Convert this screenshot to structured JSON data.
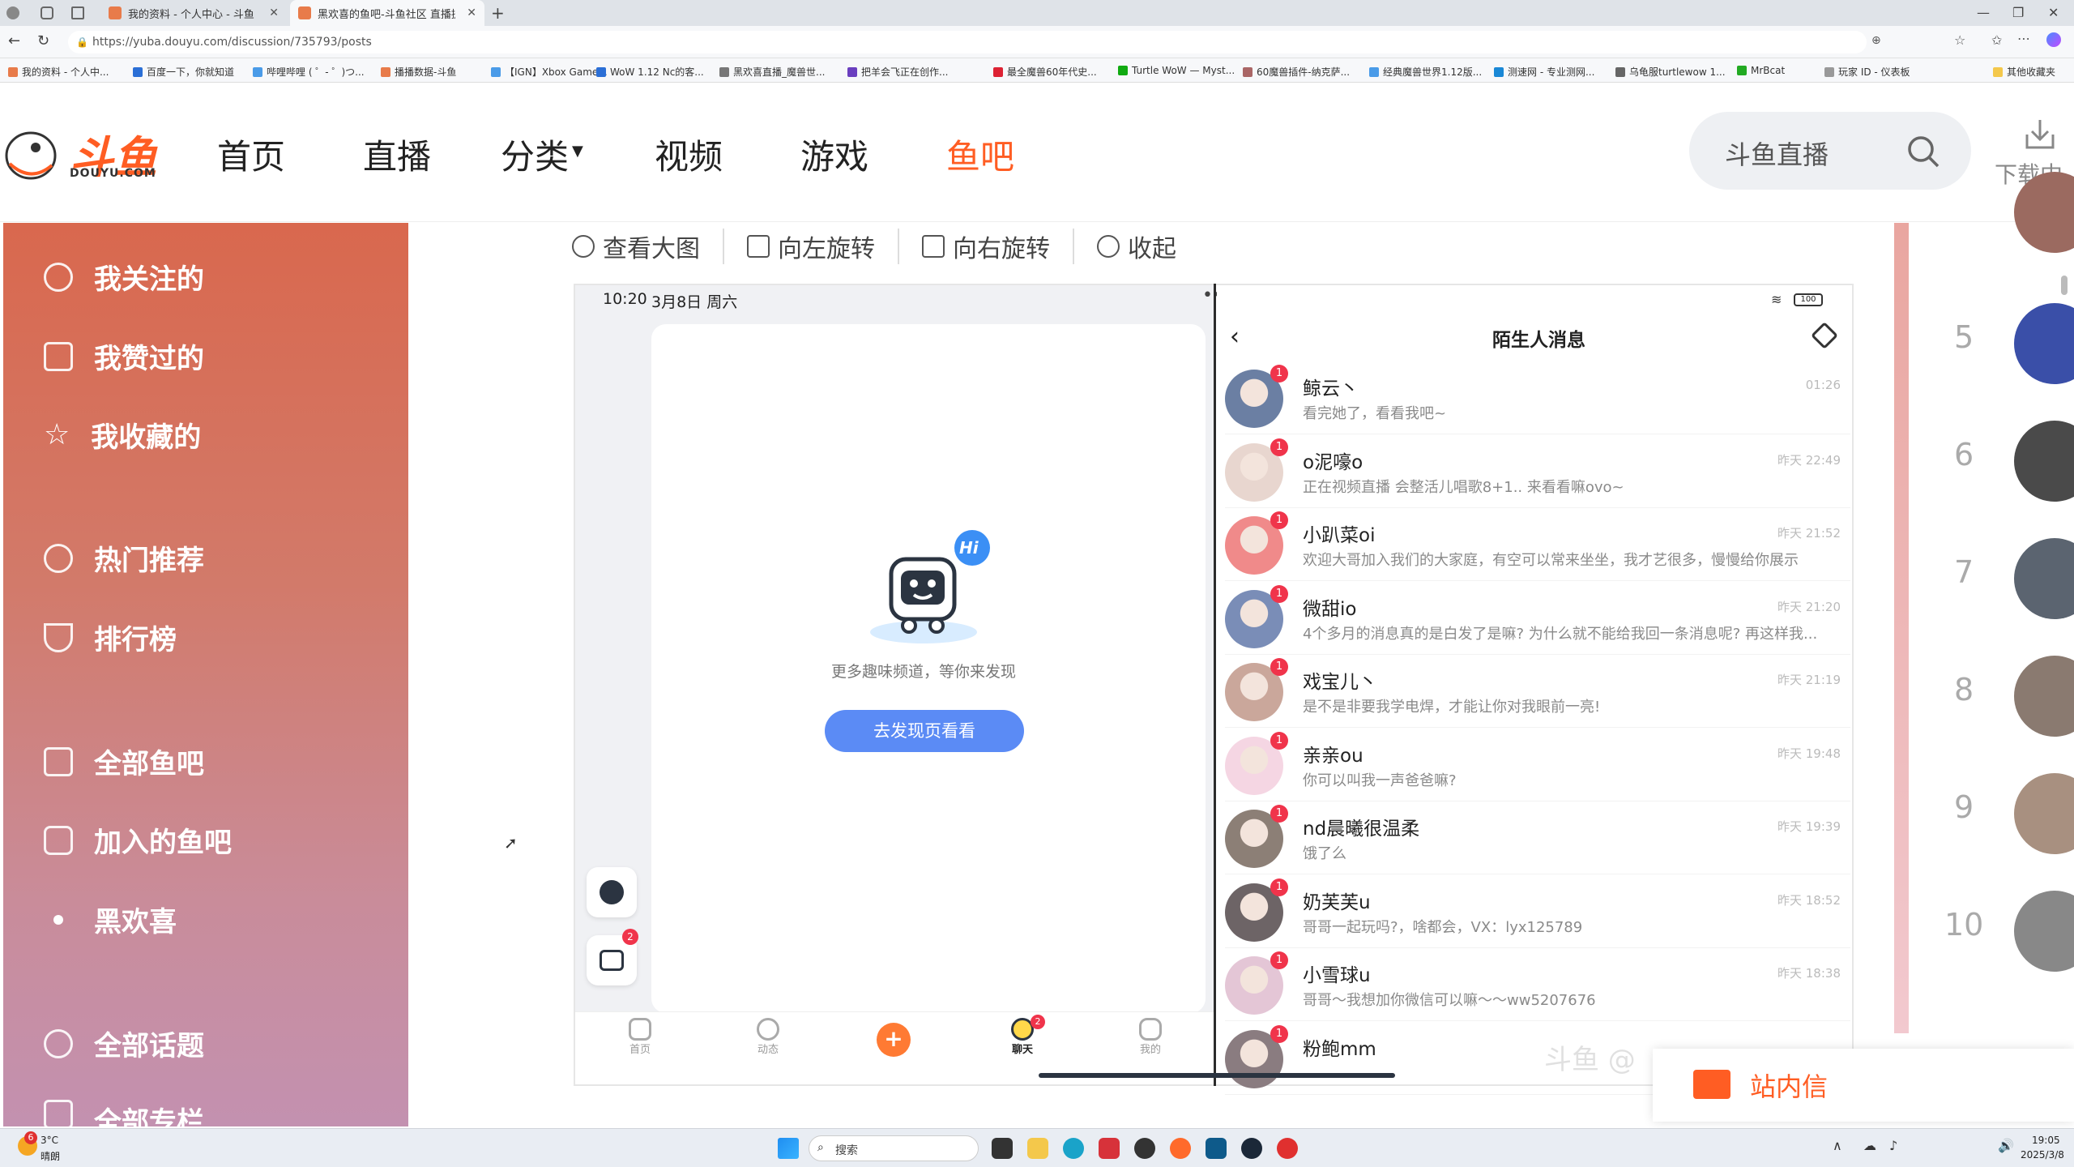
{
  "browser": {
    "tabs": [
      {
        "label": "我的资料 - 个人中心 - 斗鱼",
        "active": false
      },
      {
        "label": "黑欢喜的鱼吧-斗鱼社区 直播提示",
        "active": true
      }
    ],
    "url": "https://yuba.douyu.com/discussion/735793/posts",
    "bookmarks": [
      "我的资料 - 个人中...",
      "百度一下，你就知道",
      "哔哩哔哩 ( ゜- ゜)つ...",
      "播播数据-斗鱼",
      "【IGN】Xbox Game...",
      "WoW 1.12 Nc的客...",
      "黑欢喜直播_魔兽世...",
      "把羊会飞正在创作...",
      "最全魔兽60年代史...",
      "Turtle WoW — Myst...",
      "60魔兽插件-纳克萨...",
      "经典魔兽世界1.12版...",
      "测速网 - 专业测网...",
      "乌龟服turtlewow 1...",
      "MrBcat",
      "玩家 ID - 仪表板",
      "其他收藏夹"
    ]
  },
  "site": {
    "logo_text": "斗鱼",
    "logo_sub": "DOUYU.COM",
    "nav": [
      "首页",
      "直播",
      "分类",
      "视频",
      "游戏",
      "鱼吧"
    ],
    "search_placeholder": "斗鱼直播",
    "download_label": "下载中"
  },
  "sidebar": {
    "items": [
      {
        "label": "我关注的",
        "icon": "crown-icon"
      },
      {
        "label": "我赞过的",
        "icon": "thumb-up-icon"
      },
      {
        "label": "我收藏的",
        "icon": "star-icon"
      },
      {
        "label": "热门推荐",
        "icon": "flame-icon"
      },
      {
        "label": "排行榜",
        "icon": "trophy-icon"
      },
      {
        "label": "全部鱼吧",
        "icon": "home-icon"
      },
      {
        "label": "加入的鱼吧",
        "icon": "joined-icon"
      },
      {
        "label": "黑欢喜",
        "icon": "dot-icon"
      },
      {
        "label": "全部话题",
        "icon": "hash-icon"
      },
      {
        "label": "全部专栏",
        "icon": "column-icon"
      }
    ]
  },
  "image_toolbar": [
    "查看大图",
    "向左旋转",
    "向右旋转",
    "收起"
  ],
  "phone": {
    "time": "10:20",
    "date": "3月8日 周六",
    "battery": "100",
    "empty_hint": "更多趣味频道，等你来发现",
    "discover_btn": "去发现页看看",
    "hi": "Hi",
    "bottom_nav": [
      "首页",
      "动态",
      "+",
      "聊天",
      "我的"
    ],
    "chat_badge": "2",
    "inbox_badge": "2",
    "chat_title": "陌生人消息",
    "messages": [
      {
        "name": "鲸云丶",
        "text": "看完她了，看看我吧~",
        "time": "01:26",
        "badge": "1"
      },
      {
        "name": "o泥嚎o",
        "text": "正在视频直播 会整活儿唱歌8+1.. 来看看嘛ovo~",
        "time": "昨天 22:49",
        "badge": "1"
      },
      {
        "name": "小趴菜oi",
        "text": "欢迎大哥加入我们的大家庭，有空可以常来坐坐，我才艺很多，慢慢给你展示",
        "time": "昨天 21:52",
        "badge": "1"
      },
      {
        "name": "微甜io",
        "text": "4个多月的消息真的是白发了是嘛? 为什么就不能给我回一条消息呢? 再这样我...",
        "time": "昨天 21:20",
        "badge": "1"
      },
      {
        "name": "戏宝儿丶",
        "text": "是不是非要我学电焊，才能让你对我眼前一亮!",
        "time": "昨天 21:19",
        "badge": "1"
      },
      {
        "name": "亲亲ou",
        "text": "你可以叫我一声爸爸嘛?",
        "time": "昨天 19:48",
        "badge": "1"
      },
      {
        "name": "nd晨曦很温柔",
        "text": "饿了么",
        "time": "昨天 19:39",
        "badge": "1"
      },
      {
        "name": "奶芙芙u",
        "text": "哥哥一起玩吗?，啥都会，VX：lyx125789",
        "time": "昨天 18:52",
        "badge": "1"
      },
      {
        "name": "小雪球u",
        "text": "哥哥～我想加你微信可以嘛～～ww5207676",
        "time": "昨天 18:38",
        "badge": "1"
      },
      {
        "name": "粉鲍mm",
        "text": "",
        "time": "",
        "badge": "1"
      }
    ]
  },
  "ranking": [
    "5",
    "6",
    "7",
    "8",
    "9",
    "10"
  ],
  "inbox": {
    "label": "站内信"
  },
  "watermark": "斗鱼 @",
  "taskbar": {
    "weather_temp": "3°C",
    "weather_desc": "晴朗",
    "weather_badge": "6",
    "search_label": "搜索",
    "time": "19:05",
    "date": "2025/3/8"
  },
  "colors": {
    "brand": "#ff5d23",
    "discover_btn": "#5b8bf5",
    "badge": "#f0344b"
  }
}
